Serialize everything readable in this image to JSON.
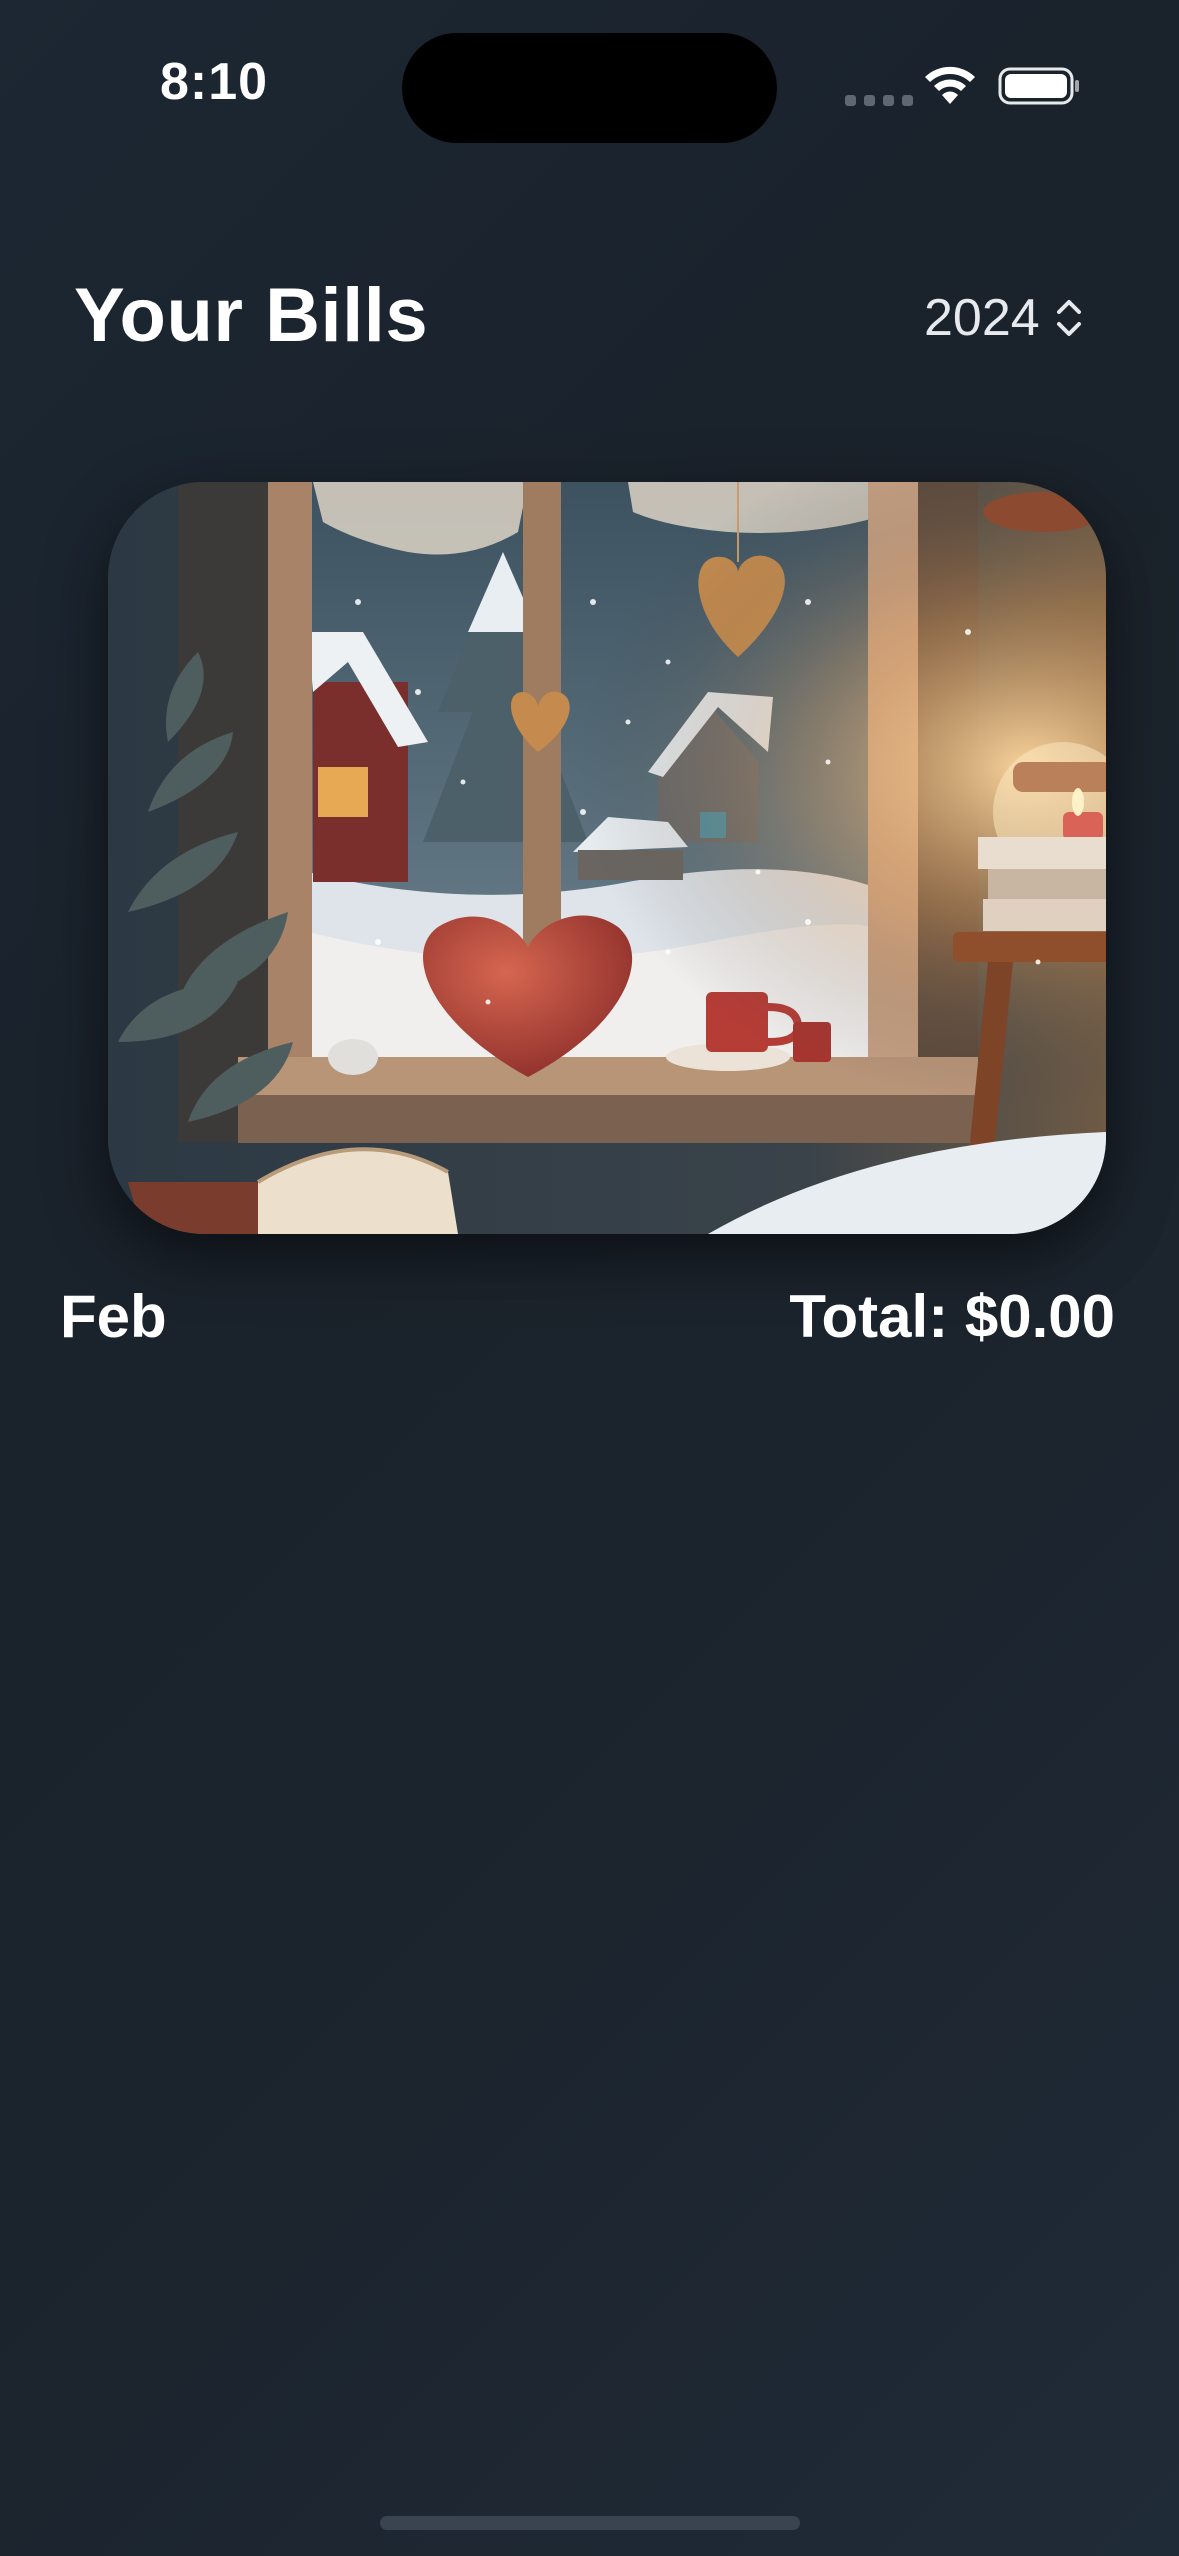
{
  "status_bar": {
    "time": "8:10"
  },
  "header": {
    "title": "Your Bills",
    "year": "2024"
  },
  "bills": [
    {
      "month": "Feb",
      "total": "Total: $0.00",
      "image_icon": "cozy-winter-window-illustration"
    }
  ],
  "colors": {
    "background": "#1b232c",
    "text": "#ffffff",
    "accent_heart": "#b8433a",
    "window_glow": "#f2c27e"
  }
}
